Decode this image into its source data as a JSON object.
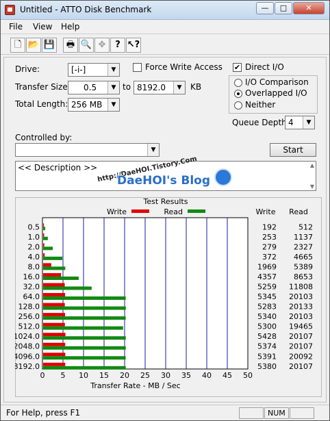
{
  "window": {
    "title": "Untitled - ATTO Disk Benchmark",
    "min": "—",
    "max": "□",
    "close": "✕"
  },
  "menu": {
    "file": "File",
    "view": "View",
    "help": "Help"
  },
  "toolbar": {
    "icons": [
      "new-document-icon",
      "open-folder-icon",
      "save-icon",
      "print-icon",
      "print-preview-icon",
      "move-icon",
      "help-icon",
      "context-help-icon"
    ]
  },
  "form": {
    "drive_label": "Drive:",
    "drive_value": "[-i-]",
    "transfer_label": "Transfer Size:",
    "transfer_from": "0.5",
    "to_label": "to",
    "transfer_to": "8192.0",
    "unit": "KB",
    "length_label": "Total Length:",
    "length_value": "256 MB",
    "force_write": "Force Write Access",
    "direct_io": "Direct I/O",
    "io_comparison": "I/O Comparison",
    "overlapped_io": "Overlapped I/O",
    "neither": "Neither",
    "queue_label": "Queue Depth:",
    "queue_value": "4",
    "controlled_label": "Controlled by:",
    "controlled_value": "",
    "start_button": "Start",
    "description": "<< Description >>"
  },
  "watermark": {
    "url": "http://DaeHOI.Tistory.Com",
    "title": "DaeHOI's Blog"
  },
  "status": {
    "help": "For Help, press F1",
    "num": "NUM"
  },
  "chart_data": {
    "type": "bar",
    "title": "Test Results",
    "xlabel": "Transfer Rate - MB / Sec",
    "xlim": [
      0,
      50
    ],
    "xticks": [
      "0",
      "5",
      "10",
      "15",
      "20",
      "25",
      "30",
      "35",
      "40",
      "45",
      "50"
    ],
    "categories": [
      "0.5",
      "1.0",
      "2.0",
      "4.0",
      "8.0",
      "16.0",
      "32.0",
      "64.0",
      "128.0",
      "256.0",
      "512.0",
      "1024.0",
      "2048.0",
      "4096.0",
      "8192.0"
    ],
    "column_headers": {
      "write": "Write",
      "read": "Read"
    },
    "series": [
      {
        "name": "Write",
        "color": "#e00000",
        "values": [
          0.19,
          0.25,
          0.28,
          0.37,
          1.97,
          4.36,
          5.26,
          5.35,
          5.28,
          5.34,
          5.3,
          5.43,
          5.37,
          5.39,
          5.38
        ],
        "labels": [
          "192",
          "253",
          "279",
          "372",
          "1969",
          "4357",
          "5259",
          "5345",
          "5283",
          "5340",
          "5300",
          "5428",
          "5374",
          "5391",
          "5380"
        ]
      },
      {
        "name": "Read",
        "color": "#128a12",
        "values": [
          0.51,
          1.14,
          2.33,
          4.67,
          5.39,
          8.65,
          11.81,
          20.1,
          20.13,
          20.1,
          19.47,
          20.11,
          20.11,
          20.09,
          20.11
        ],
        "labels": [
          "512",
          "1137",
          "2327",
          "4665",
          "5389",
          "8653",
          "11808",
          "20103",
          "20133",
          "20103",
          "19465",
          "20107",
          "20107",
          "20092",
          "20107"
        ]
      }
    ]
  }
}
